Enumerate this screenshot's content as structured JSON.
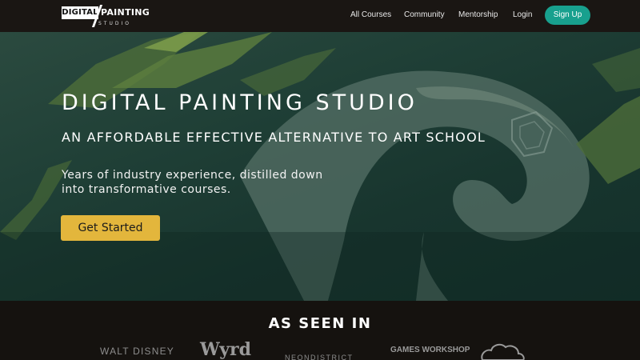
{
  "header": {
    "logo": {
      "primary": "DIGITAL",
      "secondary": "PAINTING",
      "sub": "STUDIO"
    },
    "nav": [
      "All Courses",
      "Community",
      "Mentorship",
      "Login"
    ],
    "signup_label": "Sign Up",
    "colors": {
      "signup": "#18a08e",
      "nav_bg": "#1a1613"
    }
  },
  "hero": {
    "title": "DIGITAL PAINTING STUDIO",
    "subtitle": "AN AFFORDABLE EFFECTIVE ALTERNATIVE TO ART SCHOOL",
    "description": "Years of industry experience, distilled down into transformative courses.",
    "cta_label": "Get Started",
    "colors": {
      "cta": "#e3b63c"
    }
  },
  "press": {
    "title": "AS SEEN IN",
    "logos": [
      "WALT DISNEY",
      "Wyrd",
      "NEONDISTRICT",
      "GAMES WORKSHOP",
      "cloud-logo"
    ]
  }
}
